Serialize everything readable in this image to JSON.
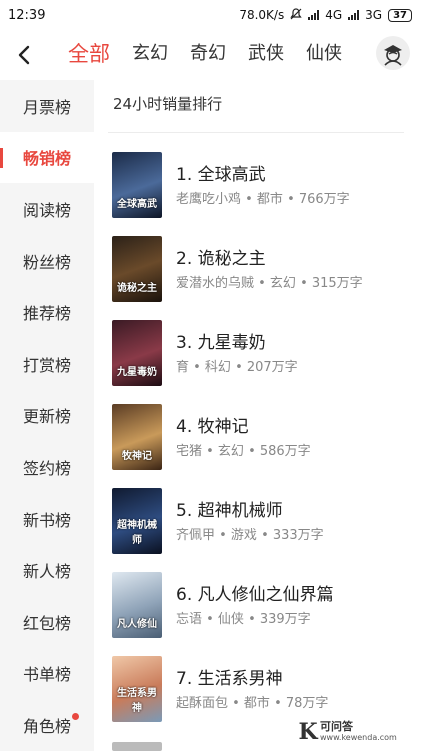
{
  "status_bar": {
    "time": "12:39",
    "speed": "78.0K/s",
    "network1": "4G",
    "network2": "3G",
    "battery": "37"
  },
  "header": {
    "tabs": [
      "全部",
      "玄幻",
      "奇幻",
      "武侠",
      "仙侠"
    ],
    "active_tab": "全部"
  },
  "sidebar": {
    "items": [
      "月票榜",
      "畅销榜",
      "阅读榜",
      "粉丝榜",
      "推荐榜",
      "打赏榜",
      "更新榜",
      "签约榜",
      "新书榜",
      "新人榜",
      "红包榜",
      "书单榜",
      "角色榜"
    ],
    "active": "畅销榜"
  },
  "list": {
    "title": "24小时销量排行",
    "books": [
      {
        "title": "1. 全球高武",
        "meta": "老鹰吃小鸡 • 都市 • 766万字",
        "cover_text": "全球高武",
        "cover_color": "#2a3a5c"
      },
      {
        "title": "2. 诡秘之主",
        "meta": "爱潜水的乌贼 • 玄幻 • 315万字",
        "cover_text": "诡秘之主",
        "cover_color": "#3b2a1e"
      },
      {
        "title": "3. 九星毒奶",
        "meta": "育 • 科幻 • 207万字",
        "cover_text": "九星毒奶",
        "cover_color": "#4a1f2a"
      },
      {
        "title": "4. 牧神记",
        "meta": "宅猪 • 玄幻 • 586万字",
        "cover_text": "牧神记",
        "cover_color": "#6b4a2e"
      },
      {
        "title": "5. 超神机械师",
        "meta": "齐佩甲 • 游戏 • 333万字",
        "cover_text": "超神机械师",
        "cover_color": "#1c2b4a"
      },
      {
        "title": "6. 凡人修仙之仙界篇",
        "meta": "忘语 • 仙侠 • 339万字",
        "cover_text": "凡人修仙",
        "cover_color": "#8fa3b8"
      },
      {
        "title": "7. 生活系男神",
        "meta": "起酥面包 • 都市 • 78万字",
        "cover_text": "生活系男神",
        "cover_color": "#c97b5a"
      }
    ]
  },
  "watermark": {
    "letter": "K",
    "cn": "可问答",
    "url": "www.kewenda.com"
  },
  "colors": {
    "accent": "#e8483f",
    "sidebar_bg": "#f5f5f5"
  }
}
